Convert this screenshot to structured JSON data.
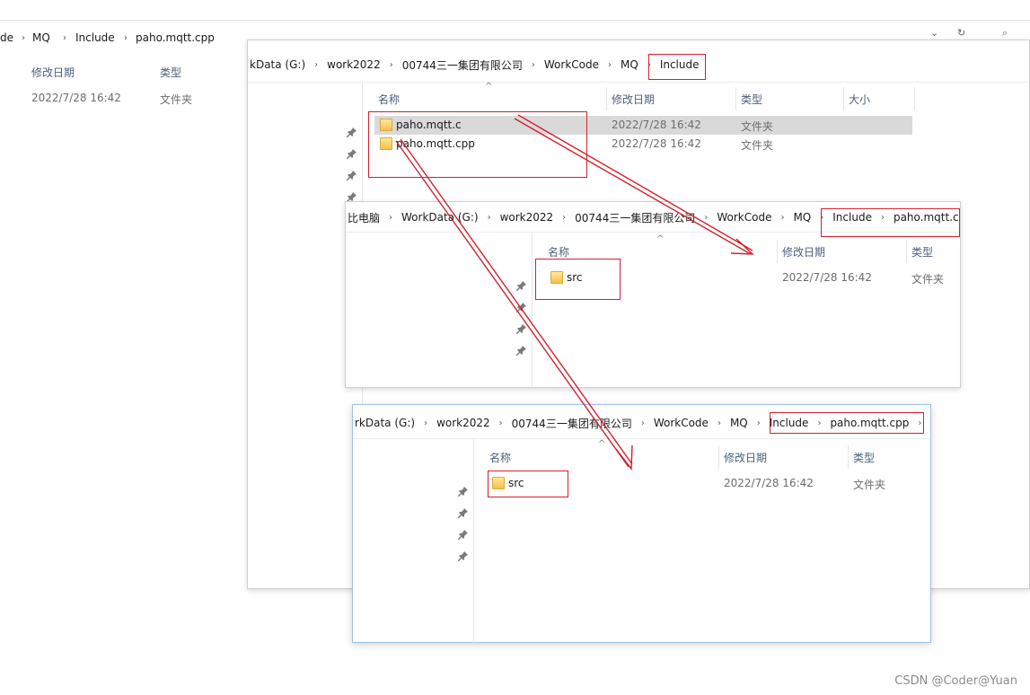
{
  "background": {
    "breadcrumb": [
      "de",
      "MQ",
      "Include",
      "paho.mqtt.cpp"
    ],
    "columns": {
      "date": "修改日期",
      "type": "类型"
    },
    "row": {
      "date": "2022/7/28 16:42",
      "type": "文件夹"
    },
    "buttons": {
      "chevron": "⌄",
      "refresh": "↻",
      "search": "⌕"
    }
  },
  "window1": {
    "breadcrumb": [
      "kData (G:)",
      "work2022",
      "00744三一集团有限公司",
      "WorkCode",
      "MQ",
      "Include"
    ],
    "columns": {
      "name": "名称",
      "date": "修改日期",
      "type": "类型",
      "size": "大小"
    },
    "rows": [
      {
        "name": "paho.mqtt.c",
        "date": "2022/7/28 16:42",
        "type": "文件夹",
        "selected": true
      },
      {
        "name": "paho.mqtt.cpp",
        "date": "2022/7/28 16:42",
        "type": "文件夹",
        "selected": false
      }
    ]
  },
  "window2": {
    "breadcrumb": [
      "比电脑",
      "WorkData (G:)",
      "work2022",
      "00744三一集团有限公司",
      "WorkCode",
      "MQ",
      "Include",
      "paho.mqtt.c"
    ],
    "columns": {
      "name": "名称",
      "date": "修改日期",
      "type": "类型"
    },
    "rows": [
      {
        "name": "src",
        "date": "2022/7/28 16:42",
        "type": "文件夹"
      }
    ]
  },
  "window3": {
    "breadcrumb": [
      "rkData (G:)",
      "work2022",
      "00744三一集团有限公司",
      "WorkCode",
      "MQ",
      "Include",
      "paho.mqtt.cpp"
    ],
    "columns": {
      "name": "名称",
      "date": "修改日期",
      "type": "类型"
    },
    "rows": [
      {
        "name": "src",
        "date": "2022/7/28 16:42",
        "type": "文件夹"
      }
    ]
  },
  "watermark": "CSDN @Coder@Yuan",
  "colors": {
    "annotation": "#d4202c",
    "folder": "#f5c04d",
    "selection": "#d9d9d9"
  }
}
